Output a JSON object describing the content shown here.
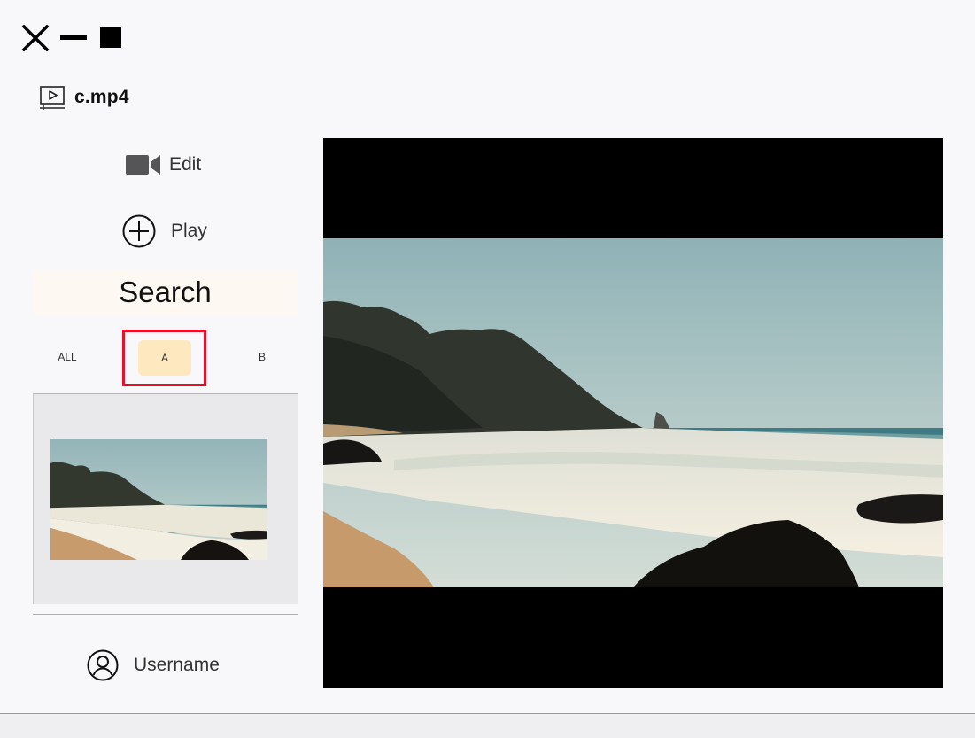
{
  "window": {
    "controls": [
      "close-icon",
      "minimize-icon",
      "maximize-icon"
    ]
  },
  "file": {
    "icon": "video-file-icon",
    "name": "c.mp4"
  },
  "sidebar": {
    "edit": {
      "icon": "video-camera-icon",
      "label": "Edit"
    },
    "play": {
      "icon": "plus-circle-icon",
      "label": "Play"
    },
    "search": {
      "label": "Search"
    },
    "filters": [
      {
        "label": "ALL",
        "selected": false
      },
      {
        "label": "A",
        "selected": true
      },
      {
        "label": "B",
        "selected": false
      }
    ],
    "user": {
      "icon": "user-circle-icon",
      "label": "Username"
    }
  },
  "colors": {
    "background": "#f8f8fa",
    "search_bg": "#fdf8f1",
    "filter_selected_bg": "#fde8bf",
    "highlight_border": "#e8102a",
    "panel_bg": "#e9e9eb",
    "player_bg": "#000000"
  }
}
